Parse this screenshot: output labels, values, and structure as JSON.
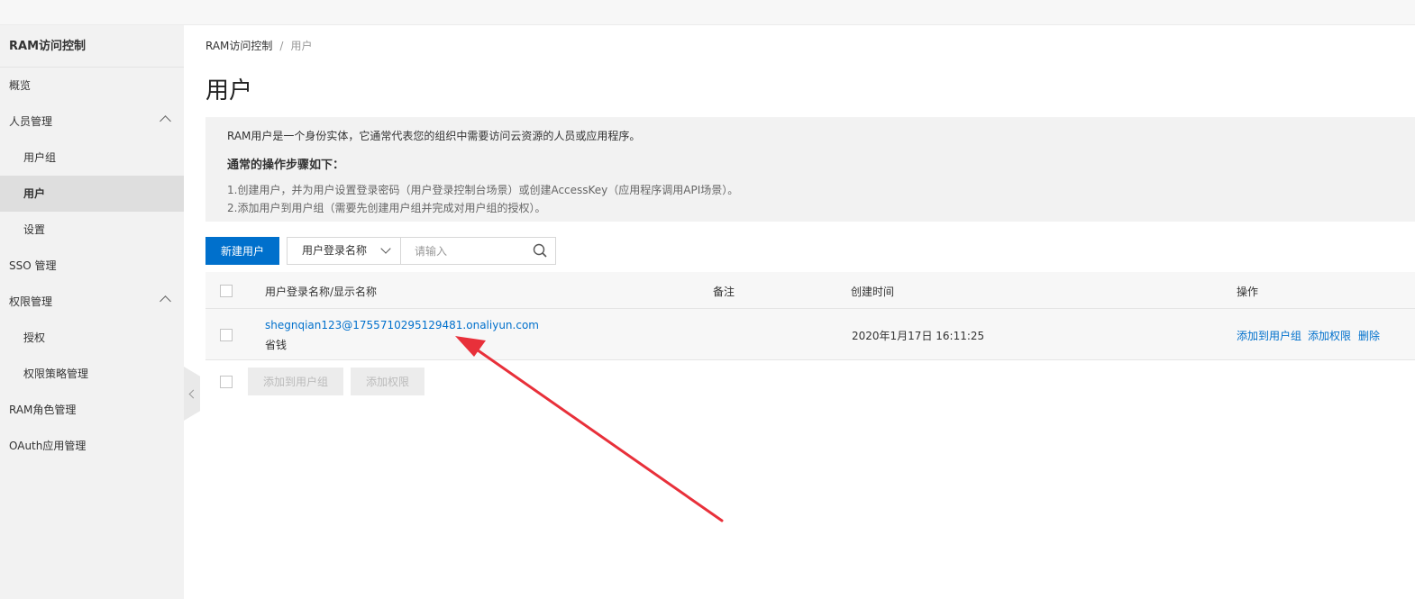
{
  "sidebar": {
    "title": "RAM访问控制",
    "items": [
      {
        "label": "概览"
      },
      {
        "label": "人员管理"
      },
      {
        "label": "用户组"
      },
      {
        "label": "用户"
      },
      {
        "label": "设置"
      },
      {
        "label": "SSO 管理"
      },
      {
        "label": "权限管理"
      },
      {
        "label": "授权"
      },
      {
        "label": "权限策略管理"
      },
      {
        "label": "RAM角色管理"
      },
      {
        "label": "OAuth应用管理"
      }
    ]
  },
  "breadcrumb": {
    "root": "RAM访问控制",
    "separator": "/",
    "current": "用户"
  },
  "page": {
    "title": "用户"
  },
  "info": {
    "intro": "RAM用户是一个身份实体，它通常代表您的组织中需要访问云资源的人员或应用程序。",
    "heading": "通常的操作步骤如下：",
    "step1": "1.创建用户，并为用户设置登录密码（用户登录控制台场景）或创建AccessKey（应用程序调用API场景）。",
    "step2": "2.添加用户到用户组（需要先创建用户组并完成对用户组的授权）。"
  },
  "toolbar": {
    "create_label": "新建用户",
    "search_field": "用户登录名称",
    "search_placeholder": "请输入"
  },
  "table": {
    "columns": [
      "用户登录名称/显示名称",
      "备注",
      "创建时间",
      "操作"
    ],
    "rows": [
      {
        "login_name": "shegnqian123@1755710295129481.onaliyun.com",
        "display_name": "省钱",
        "note": "",
        "created": "2020年1月17日 16:11:25",
        "actions": [
          "添加到用户组",
          "添加权限",
          "删除"
        ]
      }
    ]
  },
  "bulk_actions": {
    "add_to_group": "添加到用户组",
    "add_permission": "添加权限"
  },
  "colors": {
    "primary": "#0070cc",
    "annotation": "#e8303a"
  }
}
